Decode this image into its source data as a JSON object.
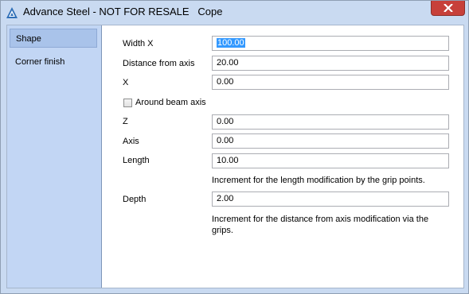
{
  "window": {
    "title": "Advance Steel - NOT FOR RESALE   Cope"
  },
  "sidebar": {
    "items": [
      {
        "label": "Shape",
        "selected": true
      },
      {
        "label": "Corner finish",
        "selected": false
      }
    ]
  },
  "form": {
    "width_x": {
      "label": "Width X",
      "value": "100.00"
    },
    "distance_from_axis": {
      "label": "Distance from axis",
      "value": "20.00"
    },
    "x": {
      "label": "X",
      "value": "0.00"
    },
    "around_beam_axis": {
      "label": "Around beam axis",
      "checked": false
    },
    "z": {
      "label": "Z",
      "value": "0.00"
    },
    "axis": {
      "label": "Axis",
      "value": "0.00"
    },
    "length": {
      "label": "Length",
      "value": "10.00",
      "hint": "Increment for the length modification by the grip points."
    },
    "depth": {
      "label": "Depth",
      "value": "2.00",
      "hint": "Increment for the distance from axis modification via the grips."
    }
  },
  "colors": {
    "titlebar": "#c9daf1",
    "sidebar": "#c2d6f4",
    "selected_item": "#a9c3ea",
    "close_button": "#c7403a",
    "selection_highlight": "#3399ff"
  },
  "icons": [
    "advance-steel-app-icon",
    "close-icon"
  ]
}
